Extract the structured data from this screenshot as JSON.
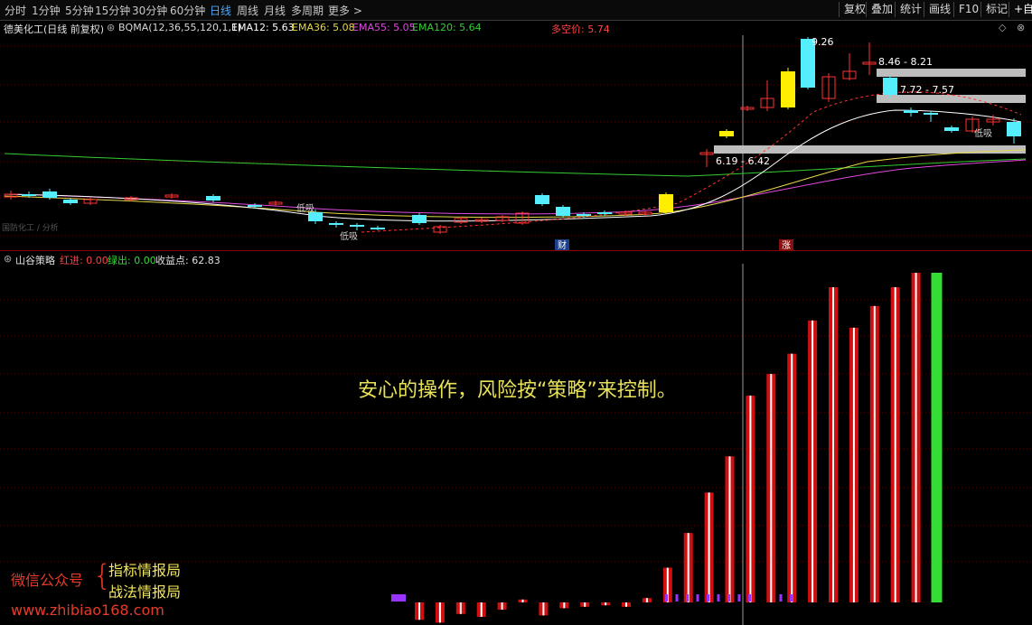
{
  "toolbar": {
    "periods": [
      "分时",
      "1分钟",
      "5分钟",
      "15分钟",
      "30分钟",
      "60分钟",
      "日线",
      "周线",
      "月线",
      "多周期",
      "更多 >"
    ],
    "active_period": "日线",
    "buttons": [
      "复权",
      "叠加",
      "统计",
      "画线",
      "F10",
      "标记",
      "+自选"
    ]
  },
  "price_panel": {
    "stock_title": "德美化工(日线 前复权)",
    "indicator": "BQMA(12,36,55,120,1,1)",
    "ema12": "EMA12: 5.63",
    "ema36": "EMA36: 5.08",
    "ema55": "EMA55: 5.05",
    "ema120": "EMA120: 5.64",
    "long_short_price": "多空价: 5.74",
    "high_label": "9.26",
    "zones": [
      "8.46 - 8.21",
      "7.72 - 7.57",
      "6.19 - 6.42"
    ],
    "buy_labels": [
      "低吸",
      "低吸",
      "低吸"
    ],
    "event_fin": "财",
    "event_rise": "涨",
    "faded_corner": "国防化工 / 分析",
    "colors": {
      "ema12": "#ffffff",
      "ema36": "#e6d84a",
      "ema55": "#e04ae0",
      "ema120": "#33cc33",
      "up": "#ff3333",
      "down": "#55eeff",
      "zone": "#bdbdbd"
    }
  },
  "indicator_panel": {
    "name": "山谷策略",
    "red_label": "红进: 0.00",
    "green_label": "绿出: 0.00",
    "profit_label": "收益点: 62.83",
    "values": [
      -12,
      -14,
      -8,
      -10,
      -5,
      2,
      -9,
      -4,
      -3,
      -2,
      -3,
      3,
      24,
      48,
      76,
      101,
      143,
      158,
      172,
      195,
      218,
      190,
      205,
      218,
      228,
      228
    ],
    "last_is_green": true,
    "caption": "安心的操作，风险按“策略”来控制。"
  },
  "watermark": {
    "wechat_label": "微信公众号",
    "brace": "{",
    "names": [
      "指标情报局",
      "战法情报局"
    ],
    "url": "www.zhibiao168.com"
  }
}
